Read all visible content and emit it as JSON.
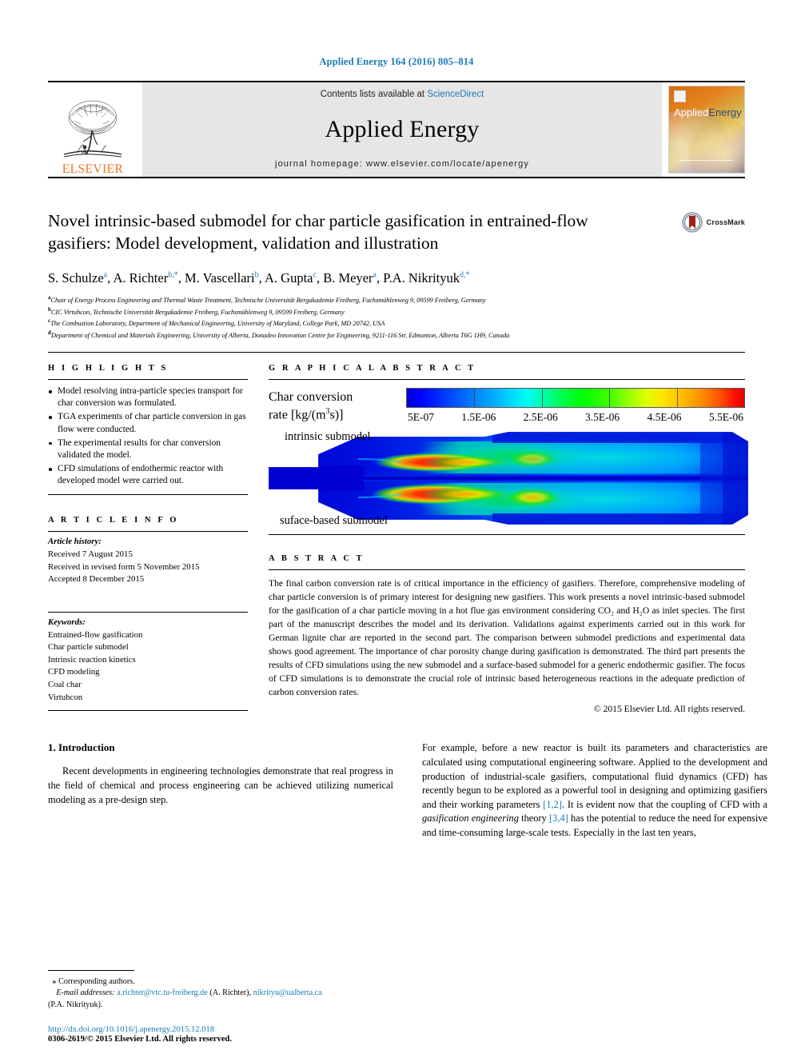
{
  "running_head": "Applied Energy 164 (2016) 805–814",
  "masthead": {
    "publisher": "ELSEVIER",
    "contents_prefix": "Contents lists available at ",
    "contents_link": "ScienceDirect",
    "journal_name": "Applied Energy",
    "homepage": "journal homepage: www.elsevier.com/locate/apenergy",
    "cover_title_first": "Applied",
    "cover_title_second": "Energy"
  },
  "article": {
    "title": "Novel intrinsic-based submodel for char particle gasification in entrained-flow gasifiers: Model development, validation and illustration",
    "crossmark_label": "CrossMark",
    "authors": [
      {
        "name": "S. Schulze",
        "sup": "a"
      },
      {
        "name": "A. Richter",
        "sup": "b,*"
      },
      {
        "name": "M. Vascellari",
        "sup": "b"
      },
      {
        "name": "A. Gupta",
        "sup": "c"
      },
      {
        "name": "B. Meyer",
        "sup": "a"
      },
      {
        "name": "P.A. Nikrityuk",
        "sup": "d,*"
      }
    ],
    "affiliations": [
      {
        "mark": "a",
        "text": "Chair of Energy Process Engineering and Thermal Waste Treatment, Technische Universität Bergakademie Freiberg, Fuchsmühlenweg 9, 09599 Freiberg, Germany"
      },
      {
        "mark": "b",
        "text": "CIC Virtuhcon, Technische Universität Bergakademie Freiberg, Fuchsmühlenweg 9, 09599 Freiberg, Germany"
      },
      {
        "mark": "c",
        "text": "The Combustion Laboratory, Department of Mechanical Engineering, University of Maryland, College Park, MD 20742, USA"
      },
      {
        "mark": "d",
        "text": "Department of Chemical and Materials Engineering, University of Alberta, Donadeo Innovation Centre for Engineering, 9211-116 Str, Edmonton, Alberta T6G 1H9, Canada"
      }
    ]
  },
  "highlights": {
    "heading": "H I G H L I G H T S",
    "items": [
      "Model resolving intra-particle species transport for char conversion was formulated.",
      "TGA experiments of char particle conversion in gas flow were conducted.",
      "The experimental results for char conversion validated the model.",
      "CFD simulations of endothermic reactor with developed model were carried out."
    ]
  },
  "article_info": {
    "heading": "A R T I C L E    I N F O",
    "history_label": "Article history:",
    "history": [
      "Received 7 August 2015",
      "Received in revised form 5 November 2015",
      "Accepted 8 December 2015"
    ],
    "keywords_label": "Keywords:",
    "keywords": [
      "Entrained-flow gasification",
      "Char particle submodel",
      "Intrinsic reaction kinetics",
      "CFD modeling",
      "Coal char",
      "Virtuhcon"
    ]
  },
  "graphical_abstract": {
    "heading": "G R A P H I C A L   A B S T R A C T",
    "caption_line1": "Char conversion",
    "caption_line2_pre": "rate [kg/(m",
    "caption_line2_sup": "3",
    "caption_line2_post": "s)]",
    "label_top": "intrinsic submodel",
    "label_bottom": "suface-based submodel"
  },
  "chart_data": {
    "type": "heatmap",
    "title": "Char conversion rate [kg/(m3 s)]",
    "colorbar_label": "Char conversion rate [kg/(m^3 s)]",
    "tick_labels": [
      "5E-07",
      "1.5E-06",
      "2.5E-06",
      "3.5E-06",
      "4.5E-06",
      "5.5E-06"
    ],
    "tick_values": [
      5e-07,
      1.5e-06,
      2.5e-06,
      3.5e-06,
      4.5e-06,
      5.5e-06
    ],
    "clim": [
      0,
      6e-06
    ],
    "colormap": "jet",
    "panels": [
      {
        "name": "intrinsic submodel",
        "position": "upper-half"
      },
      {
        "name": "suface-based submodel",
        "position": "lower-half"
      }
    ],
    "legend_position": "top",
    "grid": false
  },
  "abstract": {
    "heading": "A B S T R A C T",
    "text": "The final carbon conversion rate is of critical importance in the efficiency of gasifiers. Therefore, comprehensive modeling of char particle conversion is of primary interest for designing new gasifiers. This work presents a novel intrinsic-based submodel for the gasification of a char particle moving in a hot flue gas environment considering CO₂ and H₂O as inlet species. The first part of the manuscript describes the model and its derivation. Validations against experiments carried out in this work for German lignite char are reported in the second part. The comparison between submodel predictions and experimental data shows good agreement. The importance of char porosity change during gasification is demonstrated. The third part presents the results of CFD simulations using the new submodel and a surface-based submodel for a generic endothermic gasifier. The focus of CFD simulations is to demonstrate the crucial role of intrinsic based heterogeneous reactions in the adequate prediction of carbon conversion rates.",
    "copyright": "© 2015 Elsevier Ltd. All rights reserved."
  },
  "introduction": {
    "section_title": "1. Introduction",
    "paragraph_left": "Recent developments in engineering technologies demonstrate that real progress in the field of chemical and process engineering can be achieved utilizing numerical modeling as a pre-design step.",
    "paragraph_right_part1": "For example, before a new reactor is built its parameters and characteristics are calculated using computational engineering software. Applied to the development and production of industrial-scale gasifiers, computational fluid dynamics (CFD) has recently begun to be explored as a powerful tool in designing and optimizing gasifiers and their working parameters ",
    "ref1": "[1,2]",
    "paragraph_right_part2": ". It is evident now that the coupling of CFD with a ",
    "italic_phrase": "gasification engineering",
    "paragraph_right_part3": " theory ",
    "ref2": "[3,4]",
    "paragraph_right_part4": " has the potential to reduce the need for expensive and time-consuming large-scale tests. Especially in the last ten years,"
  },
  "footnote": {
    "corresponding": "Corresponding authors.",
    "email_label": "E-mail addresses:",
    "email1": "a.richter@vtc.tu-freiberg.de",
    "email1_owner": "(A. Richter),",
    "email2": "nikrityu@ualberta.ca",
    "email2_owner": "(P.A. Nikrityuk)."
  },
  "doi_block": {
    "doi": "http://dx.doi.org/10.1016/j.apenergy.2015.12.018",
    "issn": "0306-2619/© 2015 Elsevier Ltd. All rights reserved."
  },
  "colors": {
    "link": "#1a7bb9",
    "elsevier_orange": "#E87722",
    "masthead_gray": "#e6e6e6"
  }
}
